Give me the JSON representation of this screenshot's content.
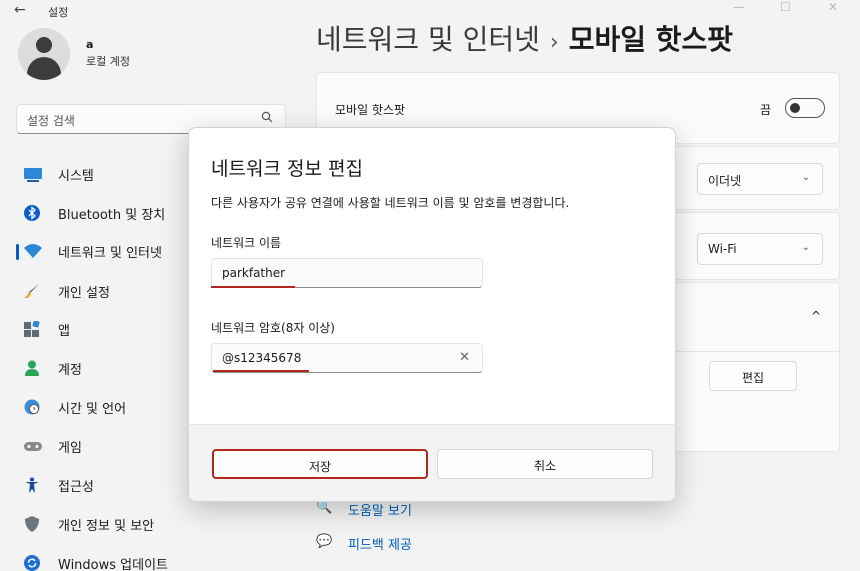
{
  "window": {
    "app_title": "설정",
    "back_glyph": "←",
    "minimize_glyph": "—",
    "maximize_glyph": "☐",
    "close_glyph": "✕"
  },
  "user": {
    "name": "a",
    "account_type": "로컬 계정"
  },
  "search": {
    "placeholder": "설정 검색",
    "icon": "search-icon"
  },
  "sidebar": {
    "items": [
      {
        "label": "시스템",
        "icon": "monitor-icon",
        "color": "#2b88d8"
      },
      {
        "label": "Bluetooth 및 장치",
        "icon": "bluetooth-icon",
        "color": "#0a5ec8"
      },
      {
        "label": "네트워크 및 인터넷",
        "icon": "wifi-icon",
        "color": "#2b88d8",
        "active": true
      },
      {
        "label": "개인 설정",
        "icon": "brush-icon",
        "color": "#e8a33a"
      },
      {
        "label": "앱",
        "icon": "apps-icon",
        "color": "#5b6b7a"
      },
      {
        "label": "계정",
        "icon": "person-icon",
        "color": "#2aa55a"
      },
      {
        "label": "시간 및 언어",
        "icon": "clock-globe-icon",
        "color": "#3b8fd6"
      },
      {
        "label": "게임",
        "icon": "gamepad-icon",
        "color": "#8a8a8a"
      },
      {
        "label": "접근성",
        "icon": "accessibility-icon",
        "color": "#1a4d9a"
      },
      {
        "label": "개인 정보 및 보안",
        "icon": "shield-icon",
        "color": "#6b7583"
      },
      {
        "label": "Windows 업데이트",
        "icon": "update-icon",
        "color": "#1f6fd1"
      }
    ]
  },
  "breadcrumb": {
    "parent": "네트워크 및 인터넷",
    "separator": "›",
    "current": "모바일 핫스팟"
  },
  "main": {
    "hotspot_label": "모바일 핫스팟",
    "hotspot_state": "끔",
    "share_from_value": "이더넷",
    "share_over_value": "Wi-Fi",
    "expand_chevron": "^",
    "edit_button": "편집",
    "help_link": "도움말 보기",
    "feedback_link": "피드백 제공"
  },
  "dialog": {
    "title": "네트워크 정보 편집",
    "description": "다른 사용자가 공유 연결에 사용할 네트워크 이름 및 암호를 변경합니다.",
    "name_label": "네트워크 이름",
    "name_value": "parkfather",
    "password_label": "네트워크 암호(8자 이상)",
    "password_value": "@s12345678",
    "clear_glyph": "✕",
    "save_button": "저장",
    "cancel_button": "취소",
    "highlight_color": "#b3261e"
  }
}
